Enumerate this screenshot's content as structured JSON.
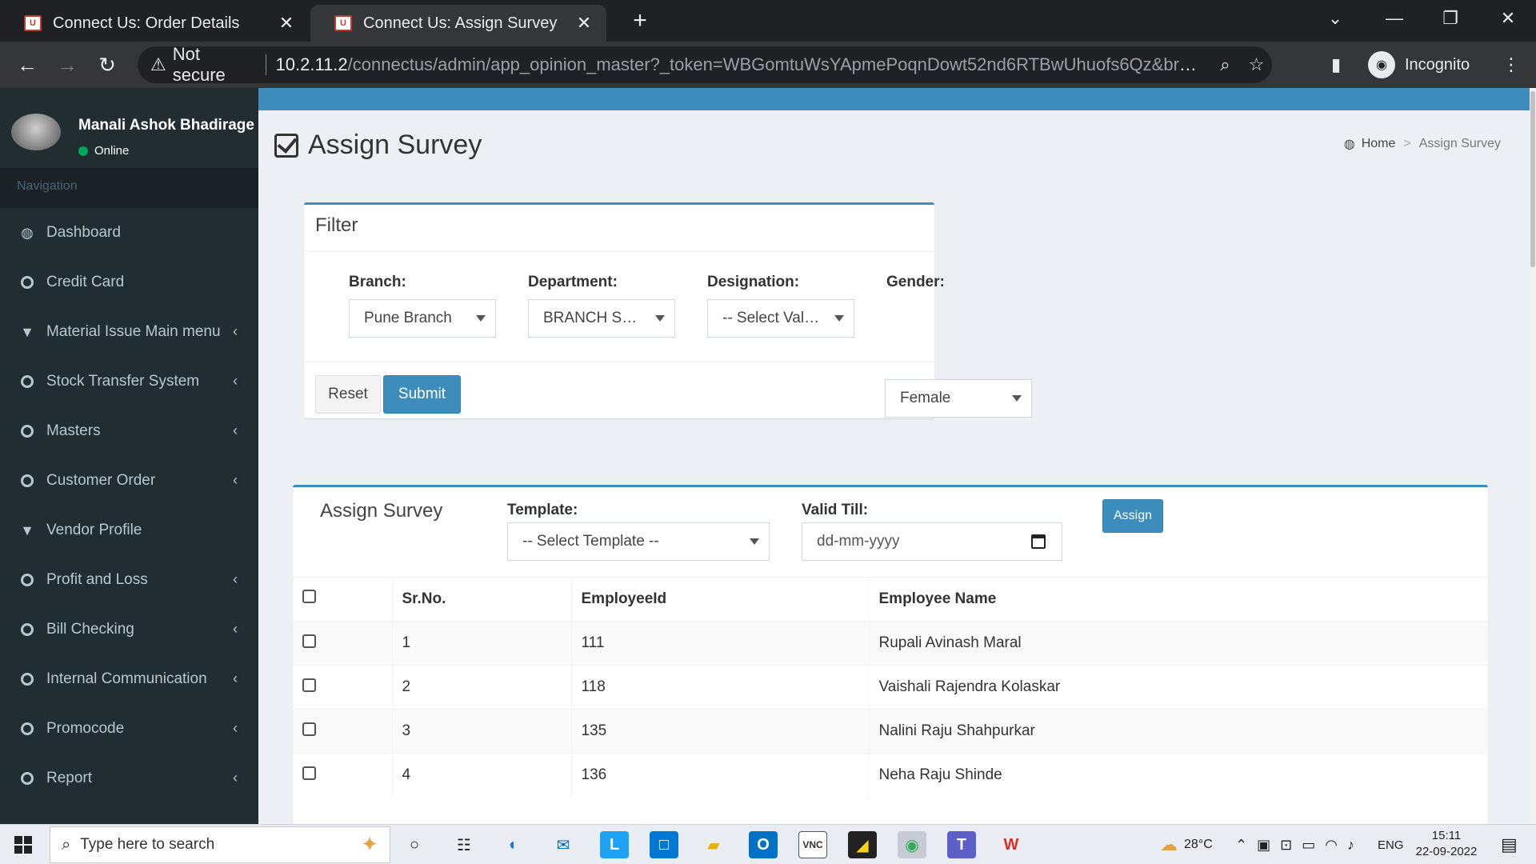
{
  "browser": {
    "tabs": [
      {
        "title": "Connect Us: Order Details",
        "active": false
      },
      {
        "title": "Connect Us: Assign Survey",
        "active": true
      }
    ],
    "security_label": "Not secure",
    "url_host": "10.2.11.2",
    "url_path": "/connectus/admin/app_opinion_master?_token=WBGomtuWsYApmePoqnDowt52nd6RTBwUhuofs6Qz&branch=...",
    "profile_label": "Incognito"
  },
  "sidebar": {
    "user_name": "Manali Ashok Bhadirage",
    "status": "Online",
    "nav_header": "Navigation",
    "items": [
      {
        "label": "Dashboard",
        "icon": "dashboard-icon",
        "has_children": false
      },
      {
        "label": "Credit Card",
        "icon": "circle-icon",
        "has_children": false
      },
      {
        "label": "Material Issue Main menu",
        "icon": "filter-icon",
        "has_children": true
      },
      {
        "label": "Stock Transfer System",
        "icon": "circle-icon",
        "has_children": true
      },
      {
        "label": "Masters",
        "icon": "circle-icon",
        "has_children": true
      },
      {
        "label": "Customer Order",
        "icon": "circle-icon",
        "has_children": true
      },
      {
        "label": "Vendor Profile",
        "icon": "filter-icon",
        "has_children": false
      },
      {
        "label": "Profit and Loss",
        "icon": "circle-icon",
        "has_children": true
      },
      {
        "label": "Bill Checking",
        "icon": "circle-icon",
        "has_children": true
      },
      {
        "label": "Internal Communication",
        "icon": "circle-icon",
        "has_children": true
      },
      {
        "label": "Promocode",
        "icon": "circle-icon",
        "has_children": true
      },
      {
        "label": "Report",
        "icon": "circle-icon",
        "has_children": true
      }
    ]
  },
  "page": {
    "title": "Assign Survey",
    "breadcrumb_home": "Home",
    "breadcrumb_current": "Assign Survey"
  },
  "filter": {
    "title": "Filter",
    "branch_label": "Branch:",
    "branch_value": "Pune Branch",
    "department_label": "Department:",
    "department_value": "BRANCH SALES",
    "designation_label": "Designation:",
    "designation_value": "-- Select Value --",
    "gender_label": "Gender:",
    "gender_value": "Female",
    "reset_label": "Reset",
    "submit_label": "Submit"
  },
  "assign": {
    "title": "Assign Survey",
    "template_label": "Template:",
    "template_value": "-- Select Template --",
    "valid_till_label": "Valid Till:",
    "valid_till_placeholder": "dd-mm-yyyy",
    "assign_label": "Assign",
    "columns": [
      "Sr.No.",
      "EmployeeId",
      "Employee Name"
    ],
    "rows": [
      {
        "sr": "1",
        "id": "111",
        "name": "Rupali Avinash Maral"
      },
      {
        "sr": "2",
        "id": "118",
        "name": "Vaishali Rajendra Kolaskar"
      },
      {
        "sr": "3",
        "id": "135",
        "name": "Nalini Raju Shahpurkar"
      },
      {
        "sr": "4",
        "id": "136",
        "name": "Neha Raju Shinde"
      }
    ]
  },
  "taskbar": {
    "search_placeholder": "Type here to search",
    "weather": "28°C",
    "language": "ENG",
    "time": "15:11",
    "date": "22-09-2022"
  },
  "colors": {
    "sidebar_bg": "#222d32",
    "primary": "#3c8dbc",
    "content_bg": "#ecf0f5"
  }
}
